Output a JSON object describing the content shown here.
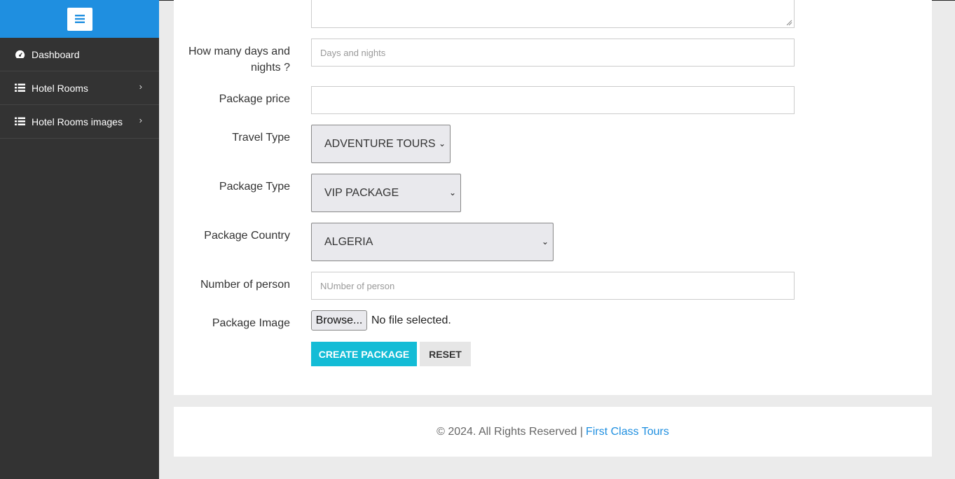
{
  "sidebar": {
    "items": [
      {
        "label": "Dashboard",
        "icon": "dashboard-icon"
      },
      {
        "label": "Hotel Rooms",
        "icon": "list-icon"
      },
      {
        "label": "Hotel Rooms images",
        "icon": "list-icon"
      }
    ]
  },
  "form": {
    "days_label": "How many days and nights ?",
    "days_placeholder": "Days and nights",
    "price_label": "Package price",
    "price_value": "",
    "travel_type_label": "Travel Type",
    "travel_type_value": "ADVENTURE TOURS",
    "package_type_label": "Package Type",
    "package_type_value": "VIP PACKAGE",
    "country_label": "Package Country",
    "country_value": "ALGERIA",
    "persons_label": "Number of person",
    "persons_placeholder": "NUmber of person",
    "image_label": "Package Image",
    "browse_label": "Browse...",
    "no_file_text": "No file selected.",
    "create_label": "CREATE PACKAGE",
    "reset_label": "RESET"
  },
  "footer": {
    "text": "© 2024. All Rights Reserved |",
    "link": "First Class Tours"
  },
  "colors": {
    "sidebar_bg": "#333333",
    "sidebar_top": "#1f8fe0",
    "create_button": "#13bcd6",
    "link": "#1f8fe0"
  }
}
